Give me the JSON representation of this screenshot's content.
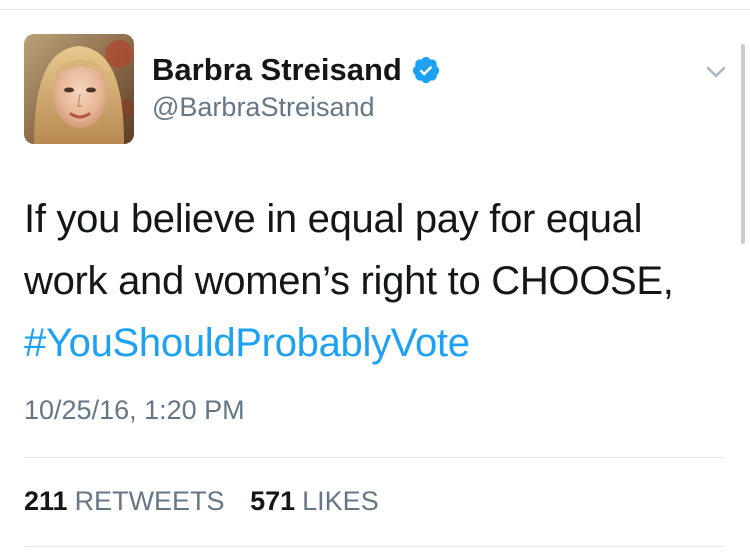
{
  "tweet": {
    "author": {
      "display_name": "Barbra Streisand",
      "handle": "@BarbraStreisand",
      "verified": true,
      "avatar_icon": "profile-photo"
    },
    "text_lines": [
      "If you believe in equal pay for equal",
      "work and women’s right to CHOOSE,"
    ],
    "hashtag": "#YouShouldProbablyVote",
    "timestamp": "10/25/16, 1:20 PM",
    "stats": {
      "retweets_count": "211",
      "retweets_label": "RETWEETS",
      "likes_count": "571",
      "likes_label": "LIKES"
    },
    "menu_icon": "chevron-down-icon"
  },
  "colors": {
    "accent": "#1da1f2",
    "text": "#14171a",
    "muted": "#657786",
    "divider": "#e1e8ed"
  }
}
